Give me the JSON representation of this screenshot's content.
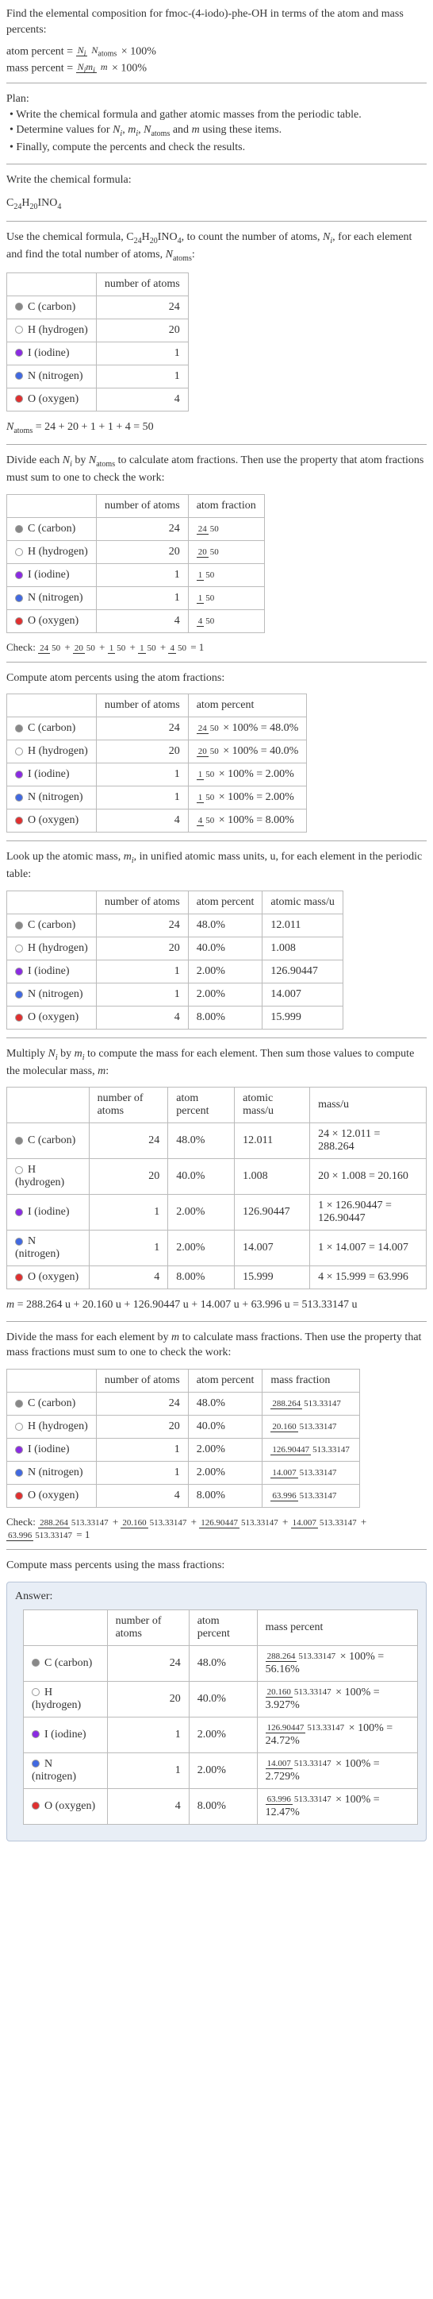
{
  "question": "Find the elemental composition for fmoc-(4-iodo)-phe-OH in terms of the atom and mass percents:",
  "atom_percent_lhs": "atom percent =",
  "atom_percent_frac_num": "N_i",
  "atom_percent_frac_den": "N_atoms",
  "times100": "× 100%",
  "mass_percent_lhs": "mass percent =",
  "mass_percent_frac_num": "N_i m_i",
  "mass_percent_frac_den": "m",
  "plan_header": "Plan:",
  "plan_b1": "• Write the chemical formula and gather atomic masses from the periodic table.",
  "plan_b2_pre": "• Determine values for ",
  "plan_b2_post": " using these items.",
  "plan_b2_vars": "N_i, m_i, N_atoms and m",
  "plan_b3": "• Finally, compute the percents and check the results.",
  "write_formula_text": "Write the chemical formula:",
  "formula": "C_24H_20INO_4",
  "count_atoms_text_pre": "Use the chemical formula, C_24H_20INO_4, to count the number of atoms, ",
  "count_atoms_text_post": ", for each element and find the total number of atoms, ",
  "N_i": "N_i",
  "N_atoms_label": "N_atoms",
  "colon": ":",
  "headers": {
    "element_blank": " ",
    "num_atoms": "number of atoms",
    "atom_fraction": "atom fraction",
    "atom_percent": "atom percent",
    "atomic_mass": "atomic mass/u",
    "mass_u": "mass/u",
    "mass_fraction": "mass fraction",
    "mass_percent": "mass percent"
  },
  "elements": [
    {
      "dot": "dot-c",
      "label": "C (carbon)",
      "n": "24"
    },
    {
      "dot": "dot-h",
      "label": "H (hydrogen)",
      "n": "20"
    },
    {
      "dot": "dot-i",
      "label": "I (iodine)",
      "n": "1"
    },
    {
      "dot": "dot-n",
      "label": "N (nitrogen)",
      "n": "1"
    },
    {
      "dot": "dot-o",
      "label": "O (oxygen)",
      "n": "4"
    }
  ],
  "N_atoms_eq": "N_atoms = 24 + 20 + 1 + 1 + 4 = 50",
  "atom_fraction_intro": "Divide each N_i by N_atoms to calculate atom fractions. Then use the property that atom fractions must sum to one to check the work:",
  "atom_fractions": [
    "24/50",
    "20/50",
    "1/50",
    "1/50",
    "4/50"
  ],
  "check_label": "Check: ",
  "atom_fraction_check": "24/50 + 20/50 + 1/50 + 1/50 + 4/50 = 1",
  "atom_percent_intro": "Compute atom percents using the atom fractions:",
  "atom_percents_calc": [
    {
      "frac": "24/50",
      "res": "48.0%"
    },
    {
      "frac": "20/50",
      "res": "40.0%"
    },
    {
      "frac": "1/50",
      "res": "2.00%"
    },
    {
      "frac": "1/50",
      "res": "2.00%"
    },
    {
      "frac": "4/50",
      "res": "8.00%"
    }
  ],
  "atomic_mass_intro": "Look up the atomic mass, m_i, in unified atomic mass units, u, for each element in the periodic table:",
  "atom_percents_simple": [
    "48.0%",
    "40.0%",
    "2.00%",
    "2.00%",
    "8.00%"
  ],
  "atomic_masses": [
    "12.011",
    "1.008",
    "126.90447",
    "14.007",
    "15.999"
  ],
  "mass_calc_intro": "Multiply N_i by m_i to compute the mass for each element. Then sum those values to compute the molecular mass, m:",
  "mass_calcs": [
    "24 × 12.011 = 288.264",
    "20 × 1.008 = 20.160",
    "1 × 126.90447 = 126.90447",
    "1 × 14.007 = 14.007",
    "4 × 15.999 = 63.996"
  ],
  "m_eq": "m = 288.264 u + 20.160 u + 126.90447 u + 14.007 u + 63.996 u = 513.33147 u",
  "mass_fraction_intro": "Divide the mass for each element by m to calculate mass fractions. Then use the property that mass fractions must sum to one to check the work:",
  "mass_fractions": [
    {
      "num": "288.264",
      "den": "513.33147"
    },
    {
      "num": "20.160",
      "den": "513.33147"
    },
    {
      "num": "126.90447",
      "den": "513.33147"
    },
    {
      "num": "14.007",
      "den": "513.33147"
    },
    {
      "num": "63.996",
      "den": "513.33147"
    }
  ],
  "mass_fraction_check": "288.264/513.33147 + 20.160/513.33147 + 126.90447/513.33147 + 14.007/513.33147 + 63.996/513.33147 = 1",
  "mass_percent_intro": "Compute mass percents using the mass fractions:",
  "answer_label": "Answer:",
  "mass_percents": [
    {
      "num": "288.264",
      "den": "513.33147",
      "res": "56.16%"
    },
    {
      "num": "20.160",
      "den": "513.33147",
      "res": "3.927%"
    },
    {
      "num": "126.90447",
      "den": "513.33147",
      "res": "24.72%"
    },
    {
      "num": "14.007",
      "den": "513.33147",
      "res": "2.729%"
    },
    {
      "num": "63.996",
      "den": "513.33147",
      "res": "12.47%"
    }
  ],
  "x100eq": "× 100% ="
}
